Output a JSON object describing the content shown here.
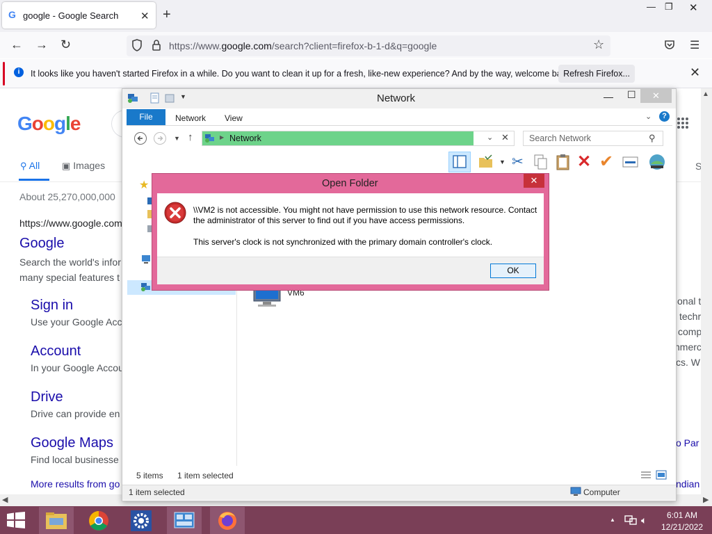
{
  "browser": {
    "tab_title": "google - Google Search",
    "url_prefix": "https://www.",
    "url_domain": "google.com",
    "url_suffix": "/search?client=firefox-b-1-d&q=google",
    "notice_text": "It looks like you haven't started Firefox in a while. Do you want to clean it up for a fresh, like-new experience? And by the way, welcome back!",
    "refresh_button": "Refresh Firefox..."
  },
  "google": {
    "logo": "Google",
    "tabs": [
      "All",
      "Images"
    ],
    "result_count": "About 25,270,000,000",
    "site_url": "https://www.google.com",
    "results": [
      {
        "title": "Google",
        "snippet": "Search the world's infor",
        "snippet2": "many special features t"
      },
      {
        "title": "Sign in",
        "snippet": "Use your Google Acc"
      },
      {
        "title": "Account",
        "snippet": "In your Google Accou"
      },
      {
        "title": "Drive",
        "snippet": "Drive can provide en"
      },
      {
        "title": "Google Maps",
        "snippet": "Find local businesse"
      }
    ],
    "more_results": "More results from go",
    "right_fragments": [
      "onal t",
      "techr",
      "comp",
      "nmerc",
      "cs. W",
      "o Par",
      "ndian"
    ],
    "right_tab_fragment": "S"
  },
  "explorer": {
    "title": "Network",
    "menu": [
      "File",
      "Network",
      "View"
    ],
    "address": "Network",
    "search_placeholder": "Search Network",
    "item_label": "VM6",
    "status_items": "5 items",
    "status_selected": "1 item selected",
    "bottom_selected": "1 item selected",
    "bottom_zone": "Computer"
  },
  "dialog": {
    "title": "Open Folder",
    "message1": "\\\\VM2 is not accessible. You might not have permission to use this network resource. Contact the administrator of this server to find out if you have access permissions.",
    "message2": "This server's clock is not synchronized with the primary domain controller's clock.",
    "ok_button": "OK"
  },
  "taskbar": {
    "time": "6:01 AM",
    "date": "12/21/2022",
    "accent_color": "#7a3f57"
  }
}
